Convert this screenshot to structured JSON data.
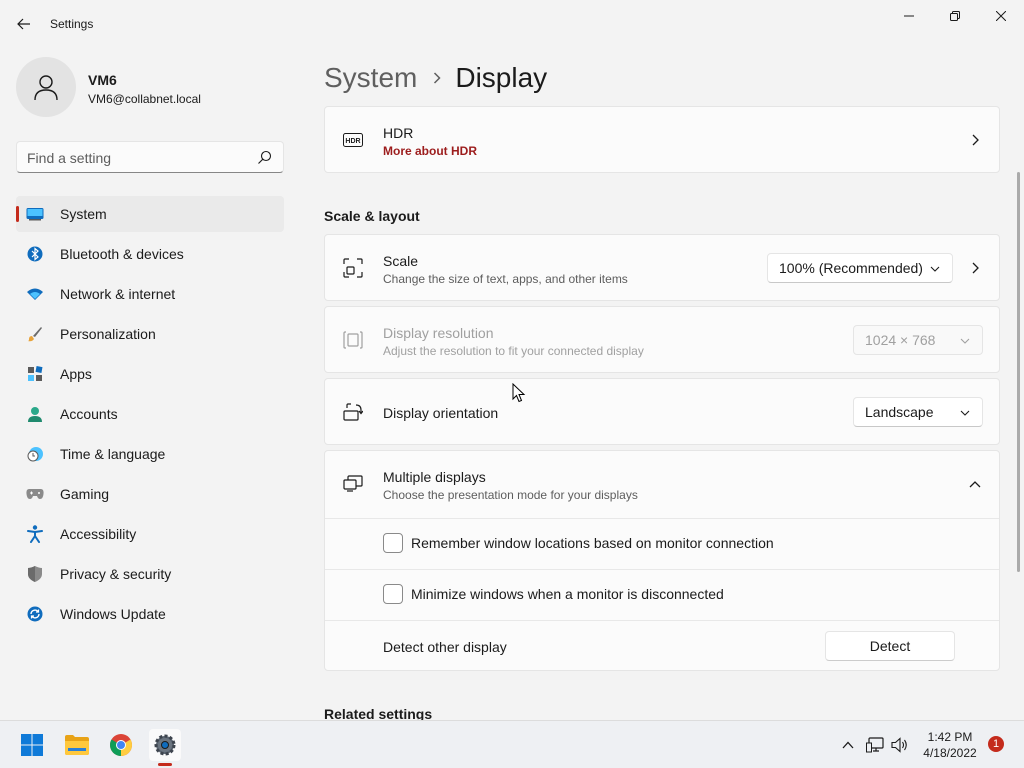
{
  "window": {
    "title": "Settings"
  },
  "profile": {
    "name": "VM6",
    "email": "VM6@collabnet.local"
  },
  "search": {
    "placeholder": "Find a setting"
  },
  "sidebar": {
    "items": [
      {
        "label": "System",
        "icon": "system-icon",
        "active": true
      },
      {
        "label": "Bluetooth & devices",
        "icon": "bluetooth-icon"
      },
      {
        "label": "Network & internet",
        "icon": "wifi-icon"
      },
      {
        "label": "Personalization",
        "icon": "brush-icon"
      },
      {
        "label": "Apps",
        "icon": "apps-icon"
      },
      {
        "label": "Accounts",
        "icon": "person-icon"
      },
      {
        "label": "Time & language",
        "icon": "clock-globe-icon"
      },
      {
        "label": "Gaming",
        "icon": "gamepad-icon"
      },
      {
        "label": "Accessibility",
        "icon": "accessibility-icon"
      },
      {
        "label": "Privacy & security",
        "icon": "shield-icon"
      },
      {
        "label": "Windows Update",
        "icon": "update-icon"
      }
    ]
  },
  "breadcrumb": {
    "parent": "System",
    "current": "Display"
  },
  "hdr": {
    "title": "HDR",
    "link": "More about HDR",
    "icon": "hdr-icon"
  },
  "scale_layout": {
    "section_title": "Scale & layout",
    "scale": {
      "title": "Scale",
      "subtitle": "Change the size of text, apps, and other items",
      "value": "100% (Recommended)",
      "icon": "scale-icon"
    },
    "resolution": {
      "title": "Display resolution",
      "subtitle": "Adjust the resolution to fit your connected display",
      "value": "1024 × 768",
      "disabled": true,
      "icon": "resolution-icon"
    },
    "orientation": {
      "title": "Display orientation",
      "value": "Landscape",
      "icon": "orientation-icon"
    },
    "multiple_displays": {
      "title": "Multiple displays",
      "subtitle": "Choose the presentation mode for your displays",
      "expanded": true,
      "icon": "multiple-displays-icon",
      "options": {
        "remember_locations": {
          "label": "Remember window locations based on monitor connection",
          "checked": false
        },
        "minimize_windows": {
          "label": "Minimize windows when a monitor is disconnected",
          "checked": false
        }
      },
      "detect": {
        "label": "Detect other display",
        "button": "Detect"
      }
    }
  },
  "related": {
    "section_title": "Related settings"
  },
  "taskbar": {
    "apps": [
      "start-icon",
      "file-explorer-icon",
      "chrome-icon",
      "settings-icon"
    ],
    "time": "1:42 PM",
    "date": "4/18/2022",
    "notification_count": "1"
  },
  "colors": {
    "accent": "#c42b1c",
    "link": "#9c1c1c",
    "background": "#f3f3f3",
    "card": "#fbfbfb"
  }
}
